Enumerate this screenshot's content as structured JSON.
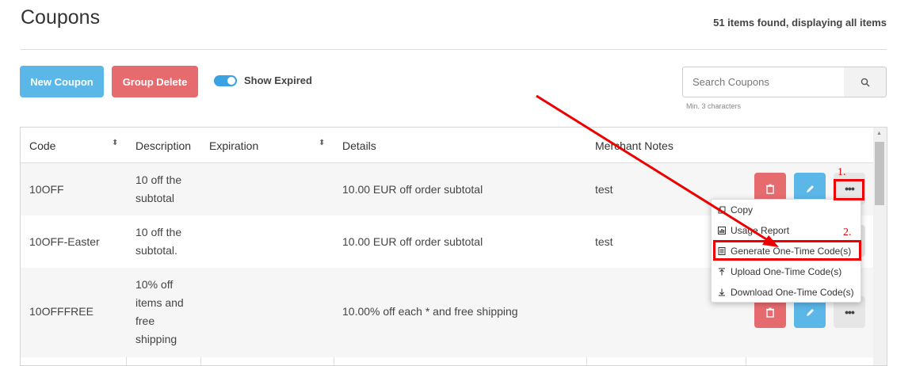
{
  "page": {
    "title": "Coupons",
    "count_text": "51 items found, displaying all items"
  },
  "toolbar": {
    "new_label": "New Coupon",
    "group_delete_label": "Group Delete",
    "show_expired_label": "Show Expired",
    "show_expired_on": true
  },
  "search": {
    "placeholder": "Search Coupons",
    "hint": "Min. 3 characters"
  },
  "table": {
    "headers": [
      "Code",
      "Description",
      "Expiration",
      "Details",
      "Merchant Notes"
    ],
    "rows": [
      {
        "code": "10OFF",
        "description": [
          "10 off the",
          "subtotal"
        ],
        "expiration": "",
        "details": "10.00 EUR off order subtotal",
        "notes": "test"
      },
      {
        "code": "10OFF-Easter",
        "description": [
          "10 off the",
          "subtotal."
        ],
        "expiration": "",
        "details": "10.00 EUR off order subtotal",
        "notes": "test"
      },
      {
        "code": "10OFFFREE",
        "description": [
          "10% off",
          "items and",
          "free",
          "shipping"
        ],
        "expiration": "",
        "details": "10.00% off each * and free shipping",
        "notes": ""
      }
    ]
  },
  "menu": {
    "items": [
      {
        "label": "Copy",
        "icon": "copy-icon"
      },
      {
        "label": "Usage Report",
        "icon": "report-icon"
      },
      {
        "label": "Generate One-Time Code(s)",
        "icon": "document-icon"
      },
      {
        "label": "Upload One-Time Code(s)",
        "icon": "upload-icon"
      },
      {
        "label": "Download One-Time Code(s)",
        "icon": "download-icon"
      }
    ]
  },
  "annotations": {
    "step1": "1.",
    "step2": "2.",
    "color": "#e00000"
  },
  "colors": {
    "primary": "#5bb7e8",
    "danger": "#e66b6f",
    "toggle": "#3aa2e3"
  }
}
